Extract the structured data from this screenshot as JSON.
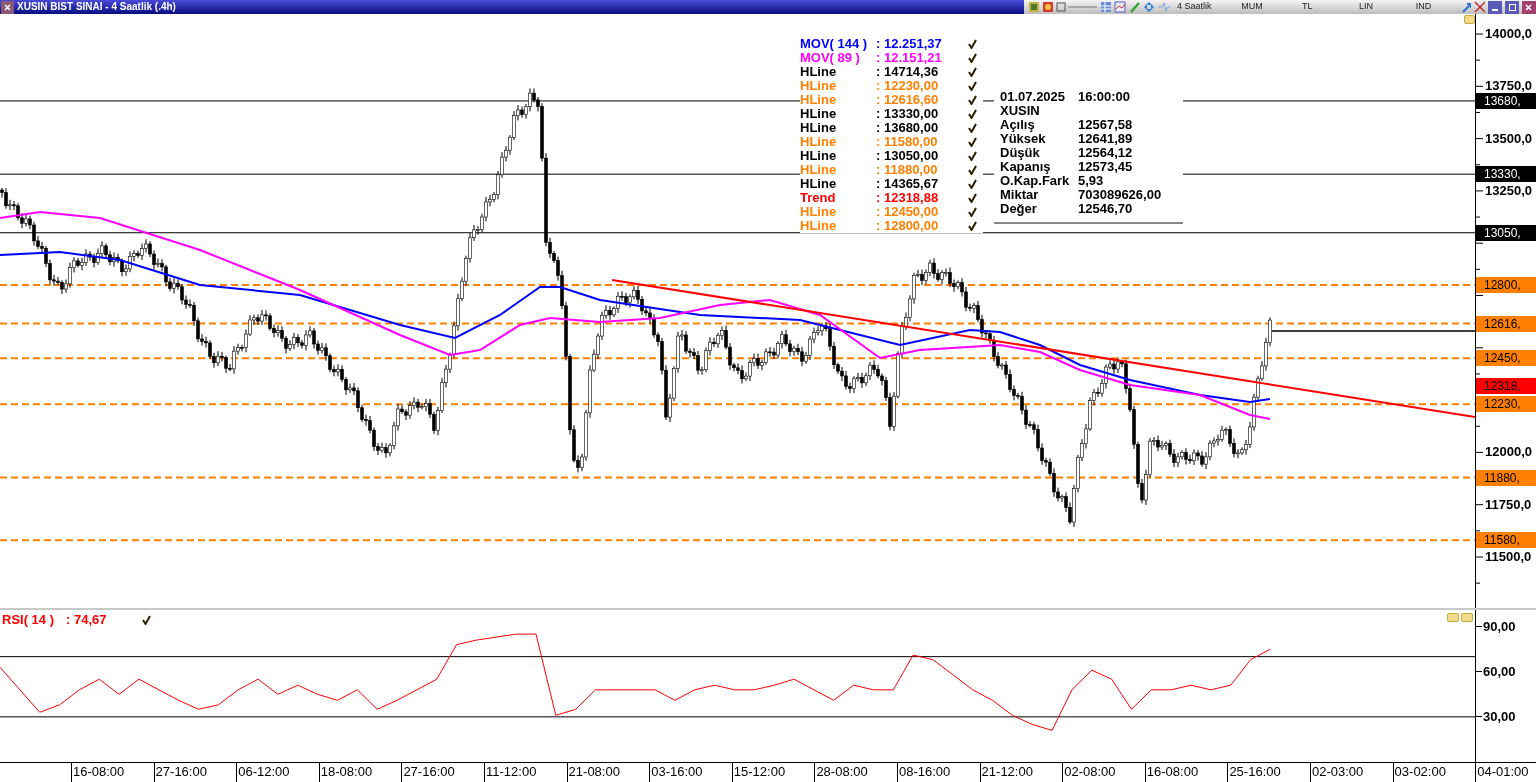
{
  "window": {
    "title": "XUSIN BIST SINAI - 4 Saatlik (.4h)"
  },
  "toolbar": {
    "period": "4 Saatlik",
    "chart_type": "MUM",
    "currency": "TL",
    "scale": "LIN",
    "indicators": "IND"
  },
  "legend": [
    {
      "kind": "ma",
      "name": "MOV( 144 )",
      "value": ": 12.251,37",
      "color": "#0000ff",
      "checked": true
    },
    {
      "kind": "ma",
      "name": "MOV( 89 )",
      "value": ": 12.151,21",
      "color": "#ff00ff",
      "checked": true
    },
    {
      "kind": "hline",
      "name": "HLine",
      "value": ": 14714,36",
      "color": "#000000",
      "checked": true
    },
    {
      "kind": "hline",
      "name": "HLine",
      "value": ": 12230,00",
      "color": "#ff8000",
      "checked": true
    },
    {
      "kind": "hline",
      "name": "HLine",
      "value": ": 12616,60",
      "color": "#ff8000",
      "checked": true
    },
    {
      "kind": "hline",
      "name": "HLine",
      "value": ": 13330,00",
      "color": "#000000",
      "checked": true
    },
    {
      "kind": "hline",
      "name": "HLine",
      "value": ": 13680,00",
      "color": "#000000",
      "checked": true
    },
    {
      "kind": "hline",
      "name": "HLine",
      "value": ": 11580,00",
      "color": "#ff8000",
      "checked": true
    },
    {
      "kind": "hline",
      "name": "HLine",
      "value": ": 13050,00",
      "color": "#000000",
      "checked": true
    },
    {
      "kind": "hline",
      "name": "HLine",
      "value": ": 11880,00",
      "color": "#ff8000",
      "checked": true
    },
    {
      "kind": "hline",
      "name": "HLine",
      "value": ": 14365,67",
      "color": "#000000",
      "checked": true
    },
    {
      "kind": "trend",
      "name": "Trend",
      "value": ": 12318,88",
      "color": "#ff0000",
      "checked": true
    },
    {
      "kind": "hline",
      "name": "HLine",
      "value": ": 12450,00",
      "color": "#ff8000",
      "checked": true
    },
    {
      "kind": "hline",
      "name": "HLine",
      "value": ": 12800,00",
      "color": "#ff8000",
      "checked": true
    }
  ],
  "info": {
    "date": "01.07.2025",
    "time": "16:00:00",
    "symbol": "XUSIN",
    "rows": [
      {
        "label": "Açılış",
        "value": "12567,58"
      },
      {
        "label": "Yüksek",
        "value": "12641,89"
      },
      {
        "label": "Düşük",
        "value": "12564,12"
      },
      {
        "label": "Kapanış",
        "value": "12573,45"
      },
      {
        "label": "O.Kap.Fark",
        "value": "5,93"
      },
      {
        "label": "Miktar",
        "value": "703089626,00"
      },
      {
        "label": "Değer",
        "value": "12546,70"
      }
    ]
  },
  "price_axis": {
    "ticks": [
      "14000,0",
      "13750,0",
      "13500,0",
      "13250,0",
      "12000,0",
      "11750,0",
      "11500,0"
    ]
  },
  "price_markers": [
    {
      "text": "13680,",
      "color": "#000000"
    },
    {
      "text": "13330,",
      "color": "#000000"
    },
    {
      "text": "13050,",
      "color": "#000000"
    },
    {
      "text": "12800,",
      "color": "#ff8000"
    },
    {
      "text": "12616,",
      "color": "#ff8000"
    },
    {
      "text": "12450,",
      "color": "#ff8000"
    },
    {
      "text": "12318,",
      "color": "#ff0000"
    },
    {
      "text": "12230,",
      "color": "#ff8000"
    },
    {
      "text": "11880,",
      "color": "#ff8000"
    },
    {
      "text": "11580,",
      "color": "#ff8000"
    }
  ],
  "rsi": {
    "value": ": 74,67",
    "checked": true,
    "chart_data": {
      "type": "line",
      "ylim": [
        0,
        101
      ],
      "yticks": [
        {
          "value": 30,
          "label": "30,00"
        },
        {
          "value": 60,
          "label": "60,00"
        },
        {
          "value": 90,
          "label": "90,00"
        }
      ],
      "series": [
        {
          "name": "RSI( 14 )",
          "color": "#ff0000",
          "values": [
            63,
            48,
            33,
            38,
            48,
            55,
            45,
            55,
            48,
            41,
            35,
            38,
            48,
            55,
            45,
            51,
            45,
            41,
            48,
            35,
            41,
            48,
            55,
            78,
            81,
            83,
            85,
            85,
            31,
            35,
            48,
            48,
            48,
            48,
            41,
            48,
            51,
            48,
            48,
            51,
            55,
            48,
            41,
            51,
            48,
            48,
            71,
            68,
            58,
            48,
            41,
            31,
            25,
            21,
            48,
            61,
            55,
            35,
            48,
            48,
            51,
            48,
            51,
            68,
            75
          ]
        }
      ]
    }
  },
  "time_axis": {
    "labels": [
      "16-08:00",
      "27-16:00",
      "06-12:00",
      "18-08:00",
      "27-16:00",
      "11-12:00",
      "21-08:00",
      "03-16:00",
      "15-12:00",
      "28-08:00",
      "08-16:00",
      "21-12:00",
      "02-08:00",
      "16-08:00",
      "25-16:00",
      "02-03:00",
      "03-02:00",
      "04-01:00"
    ]
  }
}
